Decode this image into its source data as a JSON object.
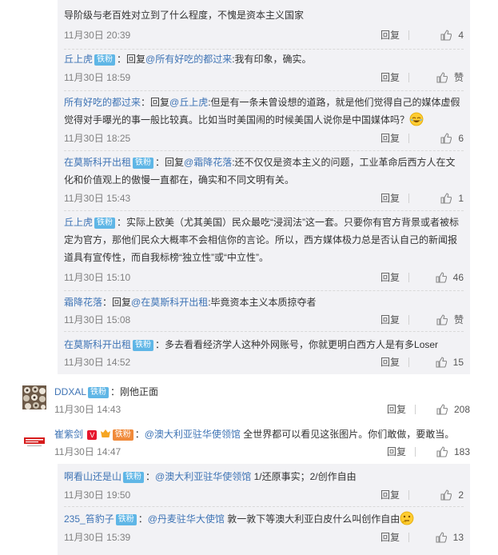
{
  "colors": {
    "username": "#eb7350",
    "link": "#3f74b5",
    "badge": "#5fb6e6",
    "meta": "#808080"
  },
  "ui": {
    "reply_label": "回复",
    "like_icon": "thumb-up-icon",
    "fans_badge": "铁粉"
  },
  "nested_replies": [
    {
      "text_tail": "导阶级与老百姓对立到了什么程度，不愧是资本主义国家",
      "time": "11月30日 20:39",
      "likes": "4"
    },
    {
      "user": "丘上虎",
      "prefix": "：回复",
      "target": "@所有好吃的都过来",
      "content": ":我有印象，确实。",
      "time": "11月30日 18:59",
      "likes": "赞"
    },
    {
      "user": "所有好吃的都过来",
      "prefix": "：回复",
      "target": "@丘上虎",
      "content": ":但是有一条未曾设想的道路，就是他们觉得自己的媒体虚假觉得对手曝光的事一般比较真。比如当时美国闹的时候美国人说你是中国媒体吗？",
      "emoji": "laugh-emoji",
      "time": "11月30日 18:25",
      "likes": "6"
    },
    {
      "user": "在莫斯科开出租",
      "prefix": "：回复",
      "target": "@霜降花落",
      "content": ":还不仅仅是资本主义的问题，工业革命后西方人在文化和价值观上的傲慢一直都在，确实和不同文明有关。",
      "time": "11月30日 15:43",
      "likes": "1"
    },
    {
      "user": "丘上虎",
      "content": "：实际上欧美（尤其美国）民众最吃“浸润法”这一套。只要你有官方背景或者被标定为官方，那他们民众大概率不会相信你的言论。所以，西方媒体极力总是否认自己的新闻报道具有宣传性，而自我标榜“独立性”或“中立性”。",
      "time": "11月30日 15:10",
      "likes": "46"
    },
    {
      "user": "霜降花落",
      "prefix": "：回复",
      "target": "@在莫斯科开出租",
      "content": ":毕竟资本主义本质掠夺者",
      "time": "11月30日 15:08",
      "likes": "赞"
    },
    {
      "user": "在莫斯科开出租",
      "content": "：多去看看经济学人这种外网账号，你就更明白西方人是有多Loser",
      "time": "11月30日 14:52",
      "likes": "15"
    }
  ],
  "comments": [
    {
      "user": "DDXAL",
      "content": "：刚他正面",
      "time": "11月30日 14:43",
      "likes": "208"
    },
    {
      "user": "崔紫剑",
      "tag": "V",
      "target": "@澳大利亚驻华使领馆",
      "content": "全世界都可以看见这张图片。你们敢做，要敢当。",
      "time": "11月30日 14:47",
      "likes": "183"
    }
  ],
  "sub_replies": [
    {
      "user": "啊看山还是山",
      "target": "@澳大利亚驻华使领馆",
      "content": "1/还原事实；2/创作自由",
      "time": "11月30日 19:50",
      "likes": "2"
    },
    {
      "user": "235_笞豹子",
      "target": "@丹麦驻华大使馆",
      "content": "敦一敦下等澳大利亚白皮什么叫创作自由",
      "emoji": "thinking-emoji",
      "time": "11月30日 15:39",
      "likes": "13"
    }
  ]
}
